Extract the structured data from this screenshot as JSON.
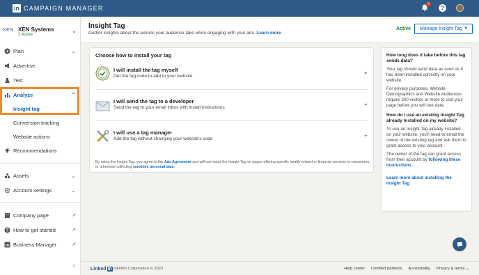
{
  "app": {
    "title": "CAMPAIGN MANAGER",
    "logo": "in",
    "notification_count": "9",
    "help": "?"
  },
  "account": {
    "brand": "XEN",
    "name": "XEN Systems",
    "status": "1 Active"
  },
  "sidebar": {
    "items": [
      {
        "label": "Plan"
      },
      {
        "label": "Advertise"
      },
      {
        "label": "Test"
      },
      {
        "label": "Analyze"
      },
      {
        "label": "Insight tag"
      },
      {
        "label": "Conversion tracking"
      },
      {
        "label": "Website actions"
      },
      {
        "label": "Recommendations"
      },
      {
        "label": "Assets"
      },
      {
        "label": "Account settings"
      },
      {
        "label": "Company page"
      },
      {
        "label": "How to get started"
      },
      {
        "label": "Business Manager"
      }
    ]
  },
  "header": {
    "title": "Insight Tag",
    "description": "Gather insights about the actions your audience take when engaging with your ads.",
    "learn_more": "Learn more",
    "status": "Active",
    "manage_button": "Manage Insight Tag"
  },
  "install": {
    "title": "Choose how to install your tag",
    "options": [
      {
        "title": "I will install the tag myself",
        "desc": "Get the tag code to add to your website"
      },
      {
        "title": "I will send the tag to a developer",
        "desc": "Send the tag to your email inbox with install instructions"
      },
      {
        "title": "I will use a tag manager",
        "desc": "Add the tag without changing your website's code"
      }
    ],
    "legal_1": "By using the Insight Tag, you agree to the",
    "legal_link1": "Ads Agreement",
    "legal_2": "and will not install the Insight Tag on pages offering specific health-related or financial services to consumers, or otherwise collecting",
    "legal_link2": "sensitive personal data",
    "legal_3": "."
  },
  "info": {
    "q1": "How long does it take before this tag sends data?",
    "p1": "Your tag should send data as soon as it has been installed correctly on your website.",
    "p2": "For privacy purposes, Website Demographics and Website Audiences require 300 visitors or more to visit your page before you will see data.",
    "q2": "How do I use an existing Insight Tag already installed on my website?",
    "p3": "To use an Insight Tag already installed on your website, you'll need to email the owner of the existing tag and ask them to grant access to your account.",
    "p4": "The owner of the tag can grant access from their account by",
    "p4_link": "following these instructions",
    "p4_end": ".",
    "more_link": "Learn more about installing the Insight Tag"
  },
  "footer": {
    "logo_text": "Linked",
    "logo_in": "in",
    "copyright": "LinkedIn Corporation © 2023",
    "links": [
      "Help center",
      "Certified partners",
      "Accessibility",
      "Privacy & terms ⌄"
    ]
  }
}
